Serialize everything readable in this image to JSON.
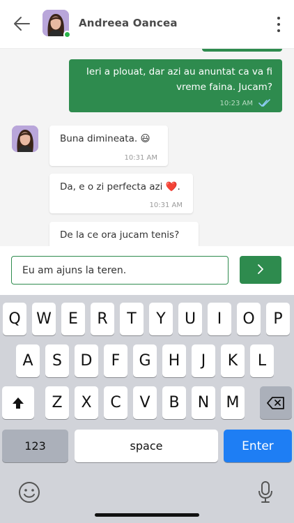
{
  "header": {
    "contact_name": "Andreea Oancea",
    "status": "online"
  },
  "messages": [
    {
      "direction": "out",
      "text": "Ieri a plouat, dar azi au anuntat ca va fi vreme faina. Jucam?",
      "time": "10:23 AM",
      "read": true
    },
    {
      "direction": "in",
      "text": "Buna dimineata.",
      "emoji": "😃",
      "time": "10:31 AM"
    },
    {
      "direction": "in",
      "text": "Da, e o zi perfecta azi",
      "emoji": "❤️",
      "trailing": ".",
      "time": "10:31 AM"
    },
    {
      "direction": "in",
      "text": "De la ce ora jucam tenis?"
    }
  ],
  "composer": {
    "value": "Eu am ajuns la teren."
  },
  "keyboard": {
    "row1": [
      "Q",
      "W",
      "E",
      "R",
      "T",
      "Y",
      "U",
      "I",
      "O",
      "P"
    ],
    "row2": [
      "A",
      "S",
      "D",
      "F",
      "G",
      "H",
      "J",
      "K",
      "L"
    ],
    "row3": [
      "Z",
      "X",
      "C",
      "V",
      "B",
      "N",
      "M"
    ],
    "numbers_label": "123",
    "space_label": "space",
    "enter_label": "Enter"
  },
  "colors": {
    "accent": "#2e8b4e",
    "online": "#2bb34a",
    "enter_key": "#1e7ef4"
  },
  "icons": [
    "back-arrow-icon",
    "more-vertical-icon",
    "double-check-icon",
    "chevron-right-icon",
    "shift-icon",
    "backspace-icon",
    "emoji-icon",
    "microphone-icon"
  ]
}
